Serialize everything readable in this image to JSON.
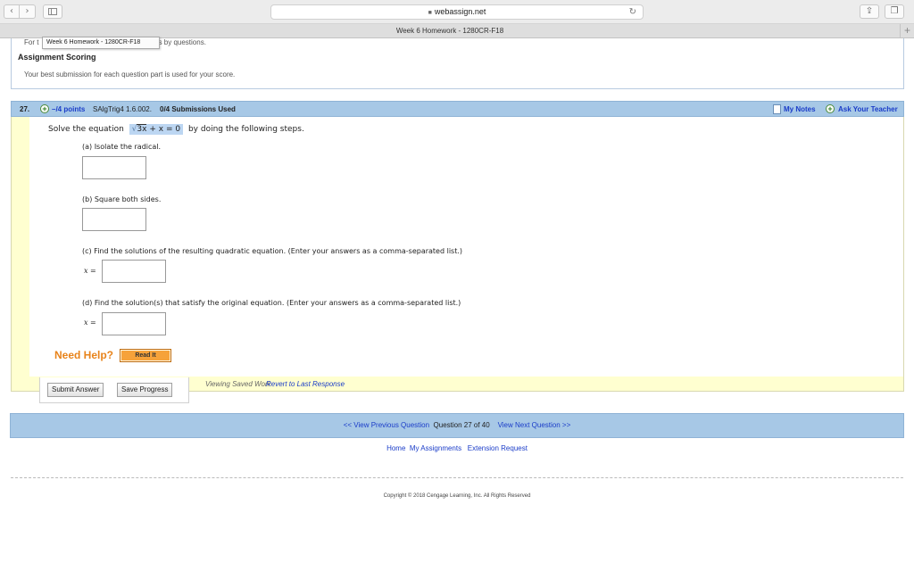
{
  "browser": {
    "url": "webassign.net",
    "tab_title": "Week 6 Homework - 1280CR-F18",
    "back_glyph": "‹",
    "forward_glyph": "›",
    "reload_glyph": "↻",
    "share_glyph": "⇪",
    "tabs_glyph": "❐",
    "newtab_glyph": "+"
  },
  "scoring": {
    "lead_start": "For t",
    "tooltip": "Week 6 Homework - 1280CR-F18",
    "lead_end": "ers by questions.",
    "title": "Assignment Scoring",
    "description": "Your best submission for each question part is used for your score."
  },
  "question": {
    "number": "27.",
    "points": "–/4 points",
    "id": "SAlgTrig4 1.6.002.",
    "submissions": "0/4 Submissions Used",
    "my_notes": "My Notes",
    "ask_teacher": "Ask Your Teacher",
    "stem_before": "Solve the equation",
    "eq_radical": "√",
    "eq_radicand": "3x",
    "eq_rest": "+ x = 0",
    "stem_after": "by doing the following steps.",
    "part_a": "(a) Isolate the radical.",
    "part_b": "(b) Square both sides.",
    "part_c": "(c) Find the solutions of the resulting quadratic equation. (Enter your answers as a comma-separated list.)",
    "part_d": "(d) Find the solution(s) that satisfy the original equation. (Enter your answers as a comma-separated list.)",
    "x_label": "x =",
    "answer_a": "",
    "answer_b": "",
    "answer_c": "",
    "answer_d": ""
  },
  "help": {
    "need_help": "Need Help?",
    "read_it": "Read It"
  },
  "actions": {
    "submit": "Submit Answer",
    "save": "Save Progress",
    "viewing": "Viewing Saved Work",
    "revert": "Revert to Last Response"
  },
  "navigation": {
    "previous": "<< View Previous Question",
    "position": "Question 27 of 40",
    "next": "View Next Question >>"
  },
  "footer": {
    "home": "Home",
    "my_assignments": "My Assignments",
    "extension": "Extension Request",
    "copyright": "Copyright © 2018 Cengage Learning, Inc. All Rights Reserved"
  },
  "colors": {
    "header_blue": "#a7c8e6",
    "link_blue": "#1a3cc8",
    "help_orange": "#e8831a",
    "question_yellow": "#ffffd0"
  }
}
